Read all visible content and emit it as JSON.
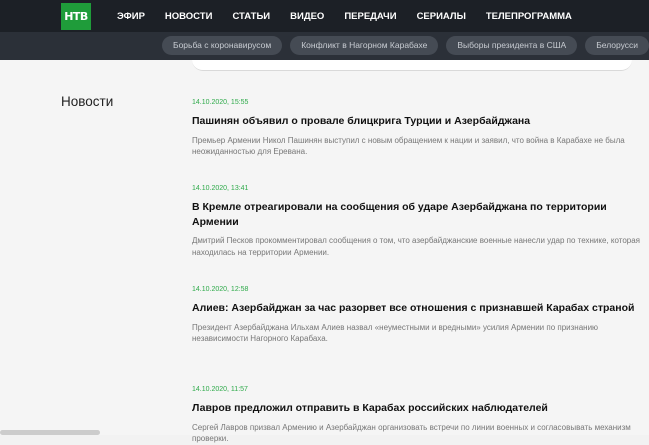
{
  "logo": {
    "text": "НТВ",
    "color": "#1f9c3a"
  },
  "nav": [
    "ЭФИР",
    "НОВОСТИ",
    "СТАТЬИ",
    "ВИДЕО",
    "ПЕРЕДАЧИ",
    "СЕРИАЛЫ",
    "ТЕЛЕПРОГРАММА"
  ],
  "tags": [
    "Борьба с коронавирусом",
    "Конфликт в Нагорном Карабахе",
    "Выборы президента в США",
    "Белорусси"
  ],
  "section_title": "Новости",
  "news": [
    {
      "date": "14.10.2020, 15:55",
      "title": "Пашинян объявил о провале блицкрига Турции и Азербайджана",
      "lead": "Премьер Армении Никол Пашинян выступил с новым обращением к нации и заявил, что война в Карабахе не была неожиданностью для Еревана."
    },
    {
      "date": "14.10.2020, 13:41",
      "title": "В Кремле отреагировали на сообщения об ударе Азербайджана по территории Армении",
      "lead": "Дмитрий Песков прокомментировал сообщения о том, что азербайджанские военные нанесли удар по технике, которая находилась на территории Армении."
    },
    {
      "date": "14.10.2020, 12:58",
      "title": "Алиев: Азербайджан за час разорвет все отношения с признавшей Карабах страной",
      "lead": "Президент Азербайджана Ильхам Алиев назвал «неуместными и вредными» усилия Армении по признанию независимости Нагорного Карабаха."
    },
    {
      "date": "14.10.2020, 11:57",
      "title": "Лавров предложил отправить в Карабах российских наблюдателей",
      "lead": "Сергей Лавров призвал Армению и Азербайджан организовать встречи по линии военных и согласовывать механизм проверки."
    }
  ]
}
